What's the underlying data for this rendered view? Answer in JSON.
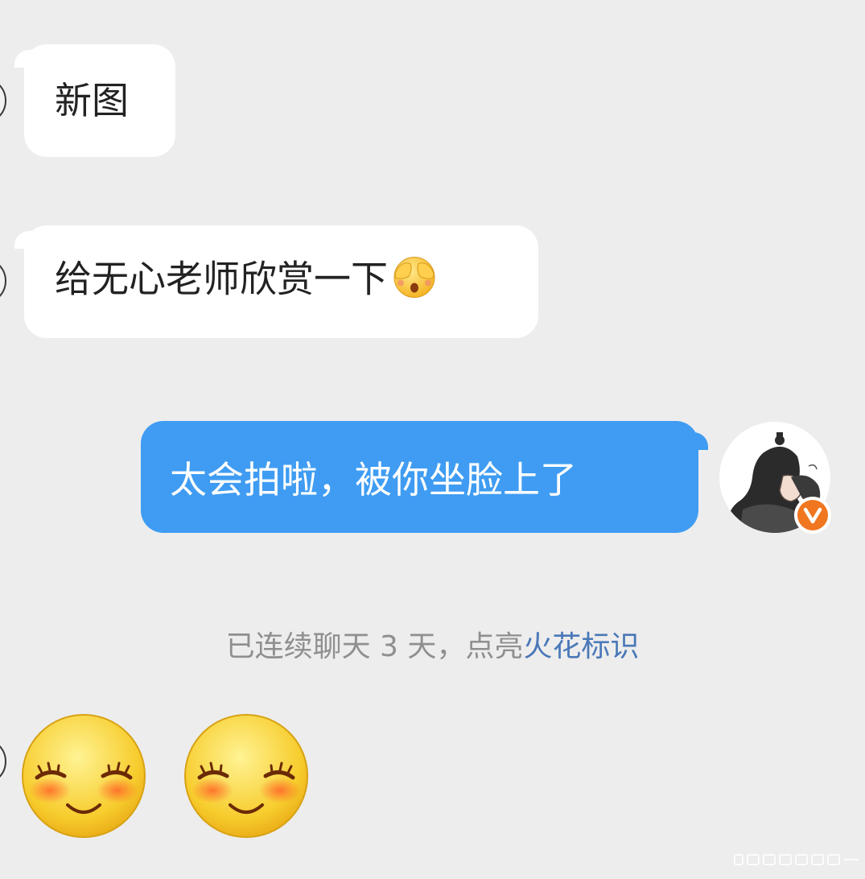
{
  "messages": [
    {
      "direction": "incoming",
      "text": "新图"
    },
    {
      "direction": "incoming",
      "text": "给无心老师欣赏一下",
      "emoji": "shy-peeking-face-emoji"
    },
    {
      "direction": "outgoing",
      "text": "太会拍啦，被你坐脸上了"
    }
  ],
  "notice": {
    "text": "已连续聊天 3 天，点亮",
    "link": "火花标识"
  },
  "stickers": [
    "blushing-smile-sticker",
    "blushing-smile-sticker"
  ],
  "my_avatar": {
    "icon": "anime-avatar",
    "badge_letter": "V",
    "badge_color": "#f0761f"
  },
  "colors": {
    "background": "#ededed",
    "incoming_bubble": "#ffffff",
    "outgoing_bubble": "#3f9cf2",
    "notice_text": "#8f8f8f",
    "notice_link": "#4a78b8"
  }
}
